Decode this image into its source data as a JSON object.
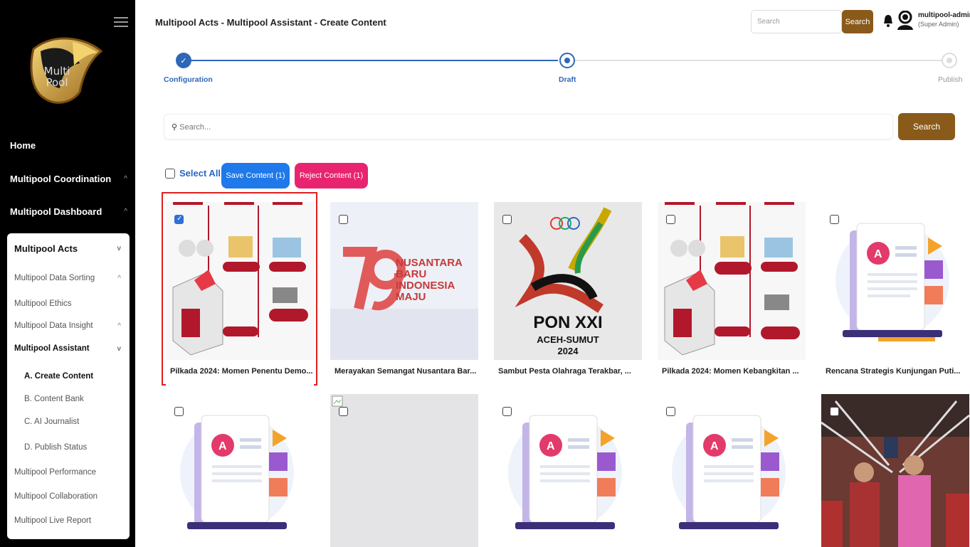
{
  "app": {
    "logo_text": "Multi\nPool",
    "title": "Multipool Acts - Multipool Assistant - Create Content"
  },
  "sidebar": {
    "top_items": [
      {
        "label": "Home",
        "chevron": ""
      },
      {
        "label": "Multipool Coordination",
        "chevron": "^"
      },
      {
        "label": "Multipool Dashboard",
        "chevron": "^"
      }
    ],
    "panel": {
      "header": {
        "label": "Multipool Acts",
        "chevron": "v"
      },
      "items": [
        {
          "label": "Multipool Data Sorting",
          "chevron": "^"
        },
        {
          "label": "Multipool Ethics",
          "chevron": ""
        },
        {
          "label": "Multipool Data Insight",
          "chevron": "^"
        },
        {
          "label": "Multipool Assistant",
          "chevron": "v"
        }
      ],
      "sub_items": [
        {
          "label": "A. Create Content",
          "active": true
        },
        {
          "label": "B. Content Bank",
          "active": false
        },
        {
          "label": "C. AI Journalist",
          "active": false
        },
        {
          "label": "D. Publish Status",
          "active": false
        }
      ],
      "bottom_items": [
        {
          "label": "Multipool Performance"
        },
        {
          "label": "Multipool Collaboration"
        },
        {
          "label": "Multipool Live Report"
        }
      ]
    }
  },
  "header": {
    "search_placeholder": "Search",
    "search_button": "Search",
    "user_name": "multipool-admin",
    "user_role": "(Super Admin)"
  },
  "stepper": {
    "steps": [
      {
        "label": "Configuration",
        "state": "done"
      },
      {
        "label": "Draft",
        "state": "active"
      },
      {
        "label": "Publish",
        "state": "pending"
      }
    ]
  },
  "content_search": {
    "placeholder": "Search...",
    "button": "Search"
  },
  "actions": {
    "select_all": "Select All",
    "save": "Save Content (1)",
    "reject": "Reject Content (1)"
  },
  "cards": [
    {
      "caption": "Pilkada 2024: Momen Penentu Demo...",
      "checked": true,
      "image": "election-infographic"
    },
    {
      "caption": "Merayakan Semangat Nusantara Bar...",
      "checked": false,
      "image": "nusantara-79-logo",
      "logo_text": "NUSANTARA\nBARU\nINDONESIA\nMAJU"
    },
    {
      "caption": "Sambut Pesta Olahraga Terakbar, ...",
      "checked": false,
      "image": "pon-xxi-logo",
      "logo_title": "PON XXI",
      "logo_sub": "ACEH-SUMUT",
      "logo_year": "2024"
    },
    {
      "caption": "Pilkada 2024: Momen Kebangkitan ...",
      "checked": false,
      "image": "election-infographic"
    },
    {
      "caption": "Rencana Strategis Kunjungan Puti...",
      "checked": false,
      "image": "document-illustration"
    },
    {
      "caption": "",
      "checked": false,
      "image": "document-illustration"
    },
    {
      "caption": "",
      "checked": false,
      "image": "broken-image"
    },
    {
      "caption": "",
      "checked": false,
      "image": "document-illustration"
    },
    {
      "caption": "",
      "checked": false,
      "image": "document-illustration"
    },
    {
      "caption": "",
      "checked": false,
      "image": "ceremony-photo"
    }
  ],
  "colors": {
    "brand_brown": "#8a5a1b",
    "save_blue": "#1f79ea",
    "reject_pink": "#e9246e",
    "step_blue": "#2f67b7",
    "selected_border": "#e02020"
  }
}
